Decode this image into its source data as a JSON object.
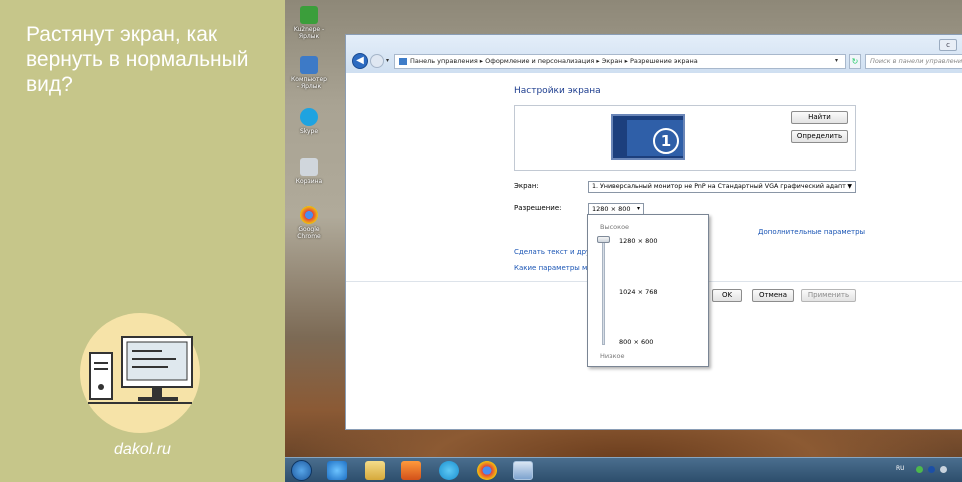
{
  "promo": {
    "title": "Растянут экран, как вернуть в нормальный вид?",
    "site": "dakol.ru"
  },
  "desktop": {
    "icons": [
      {
        "label": "Ku2nepe - Ярлык",
        "icon": "app-icon",
        "color": "#3b9e3b"
      },
      {
        "label": "Компьютер - Ярлык",
        "icon": "computer-icon",
        "color": "#3d7ac7"
      },
      {
        "label": "Skype",
        "icon": "skype-icon",
        "color": "#1fa3e0"
      },
      {
        "label": "Корзина",
        "icon": "recycle-bin-icon",
        "color": "#d0d6dc"
      },
      {
        "label": "Google Chrome",
        "icon": "chrome-icon",
        "color": "#e2443a"
      }
    ]
  },
  "window": {
    "breadcrumb": "Панель управления ▸ Оформление и персонализация ▸ Экран ▸ Разрешение экрана",
    "search_placeholder": "Поиск в панели управления",
    "close_label": "c",
    "page_title": "Настройки экрана",
    "monitor_number": "1",
    "find_label": "Найти",
    "identify_label": "Определить",
    "screen_label": "Экран:",
    "screen_value": "1. Универсальный монитор не PnP на Стандартный VGA графический адапт",
    "resolution_label": "Разрешение:",
    "resolution_value": "1280 × 800",
    "advanced_link": "Дополнительные параметры",
    "text_link": "Сделать текст и другие",
    "monitor_link": "Какие параметры мон",
    "ok_label": "OK",
    "cancel_label": "Отмена",
    "apply_label": "Применить"
  },
  "resolution_popup": {
    "high_label": "Высокое",
    "low_label": "Низкое",
    "options": [
      "1280 × 800",
      "1024 × 768",
      "800 × 600"
    ],
    "selected_index": 0
  },
  "taskbar": {
    "items": [
      "start-icon",
      "ie-icon",
      "explorer-icon",
      "media-player-icon",
      "skype-icon",
      "chrome-icon",
      "control-panel-icon"
    ],
    "lang": "RU"
  }
}
